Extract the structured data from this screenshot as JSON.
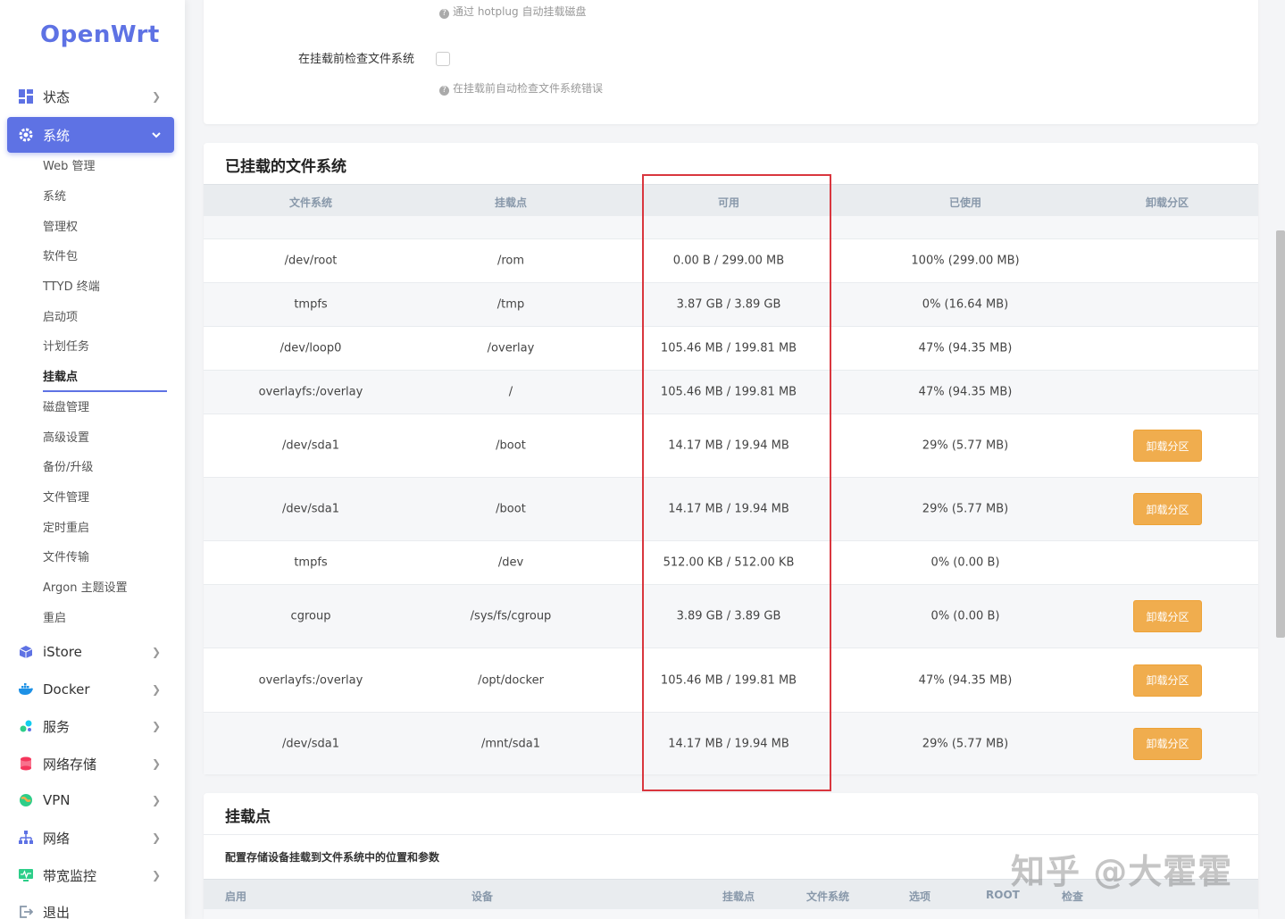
{
  "brand": "OpenWrt",
  "nav": {
    "status": "状态",
    "system": "系统",
    "istore": "iStore",
    "docker": "Docker",
    "services": "服务",
    "nas": "网络存储",
    "vpn": "VPN",
    "network": "网络",
    "bandwidth": "带宽监控",
    "logout": "退出"
  },
  "submenu": [
    "Web 管理",
    "系统",
    "管理权",
    "软件包",
    "TTYD 终端",
    "启动项",
    "计划任务",
    "挂载点",
    "磁盘管理",
    "高级设置",
    "备份/升级",
    "文件管理",
    "定时重启",
    "文件传输",
    "Argon 主题设置",
    "重启"
  ],
  "top_card": {
    "hotplug_help": "通过 hotplug 自动挂载磁盘",
    "check_label": "在挂载前检查文件系统",
    "check_help": "在挂载前自动检查文件系统错误"
  },
  "mounted": {
    "title": "已挂载的文件系统",
    "headers": [
      "文件系统",
      "挂载点",
      "可用",
      "已使用",
      "卸载分区"
    ],
    "unmount_label": "卸载分区",
    "rows": [
      {
        "fs": "/dev/root",
        "mount": "/rom",
        "avail": "0.00 B / 299.00 MB",
        "used": "100% (299.00 MB)",
        "unmount": false
      },
      {
        "fs": "tmpfs",
        "mount": "/tmp",
        "avail": "3.87 GB / 3.89 GB",
        "used": "0% (16.64 MB)",
        "unmount": false
      },
      {
        "fs": "/dev/loop0",
        "mount": "/overlay",
        "avail": "105.46 MB / 199.81 MB",
        "used": "47% (94.35 MB)",
        "unmount": false
      },
      {
        "fs": "overlayfs:/overlay",
        "mount": "/",
        "avail": "105.46 MB / 199.81 MB",
        "used": "47% (94.35 MB)",
        "unmount": false
      },
      {
        "fs": "/dev/sda1",
        "mount": "/boot",
        "avail": "14.17 MB / 19.94 MB",
        "used": "29% (5.77 MB)",
        "unmount": true
      },
      {
        "fs": "/dev/sda1",
        "mount": "/boot",
        "avail": "14.17 MB / 19.94 MB",
        "used": "29% (5.77 MB)",
        "unmount": true
      },
      {
        "fs": "tmpfs",
        "mount": "/dev",
        "avail": "512.00 KB / 512.00 KB",
        "used": "0% (0.00 B)",
        "unmount": false
      },
      {
        "fs": "cgroup",
        "mount": "/sys/fs/cgroup",
        "avail": "3.89 GB / 3.89 GB",
        "used": "0% (0.00 B)",
        "unmount": true
      },
      {
        "fs": "overlayfs:/overlay",
        "mount": "/opt/docker",
        "avail": "105.46 MB / 199.81 MB",
        "used": "47% (94.35 MB)",
        "unmount": true
      },
      {
        "fs": "/dev/sda1",
        "mount": "/mnt/sda1",
        "avail": "14.17 MB / 19.94 MB",
        "used": "29% (5.77 MB)",
        "unmount": true
      }
    ]
  },
  "mountpoints": {
    "title": "挂载点",
    "desc": "配置存储设备挂载到文件系统中的位置和参数",
    "headers": [
      "启用",
      "设备",
      "挂载点",
      "文件系统",
      "选项",
      "ROOT",
      "检查"
    ]
  },
  "watermark": "知乎 @大霍霍",
  "colors": {
    "accent": "#5e72e4",
    "warning": "#f0ad4e",
    "highlight": "#d9363e"
  }
}
